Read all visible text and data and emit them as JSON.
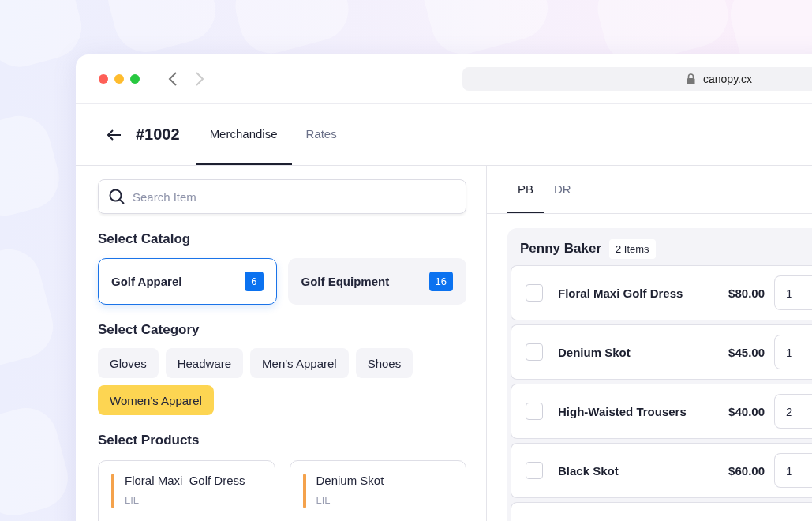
{
  "browser": {
    "url": "canopy.cx"
  },
  "header": {
    "title": "#1002",
    "tabs": [
      {
        "label": "Merchandise",
        "selected": true
      },
      {
        "label": "Rates",
        "selected": false
      }
    ]
  },
  "search": {
    "placeholder": "Search Item"
  },
  "catalog": {
    "heading": "Select Catalog",
    "items": [
      {
        "label": "Golf Apparel",
        "count": "6",
        "selected": true
      },
      {
        "label": "Golf Equipment",
        "count": "16",
        "selected": false
      }
    ]
  },
  "category": {
    "heading": "Select Category",
    "items": [
      {
        "label": "Gloves",
        "selected": false
      },
      {
        "label": "Headware",
        "selected": false
      },
      {
        "label": "Men's Apparel",
        "selected": false
      },
      {
        "label": "Shoes",
        "selected": false
      },
      {
        "label": "Women's Apparel",
        "selected": true
      }
    ]
  },
  "products": {
    "heading": "Select Products",
    "items": [
      {
        "name": "Floral Maxi  Golf Dress",
        "code": "LIL"
      },
      {
        "name": "Denium Skot",
        "code": "LIL"
      }
    ]
  },
  "customer_tabs": [
    {
      "label": "PB",
      "selected": true
    },
    {
      "label": "DR",
      "selected": false
    }
  ],
  "order": {
    "name": "Penny Baker",
    "badge": "2 Items",
    "rows": [
      {
        "name": "Floral Maxi Golf Dress",
        "price": "$80.00",
        "quantity": "1",
        "checked": false
      },
      {
        "name": "Denium Skot",
        "price": "$45.00",
        "quantity": "1",
        "checked": false
      },
      {
        "name": "High-Waisted Trousers",
        "price": "$40.00",
        "quantity": "2",
        "checked": false
      },
      {
        "name": "Black Skot",
        "price": "$60.00",
        "quantity": "1",
        "checked": false
      }
    ]
  }
}
